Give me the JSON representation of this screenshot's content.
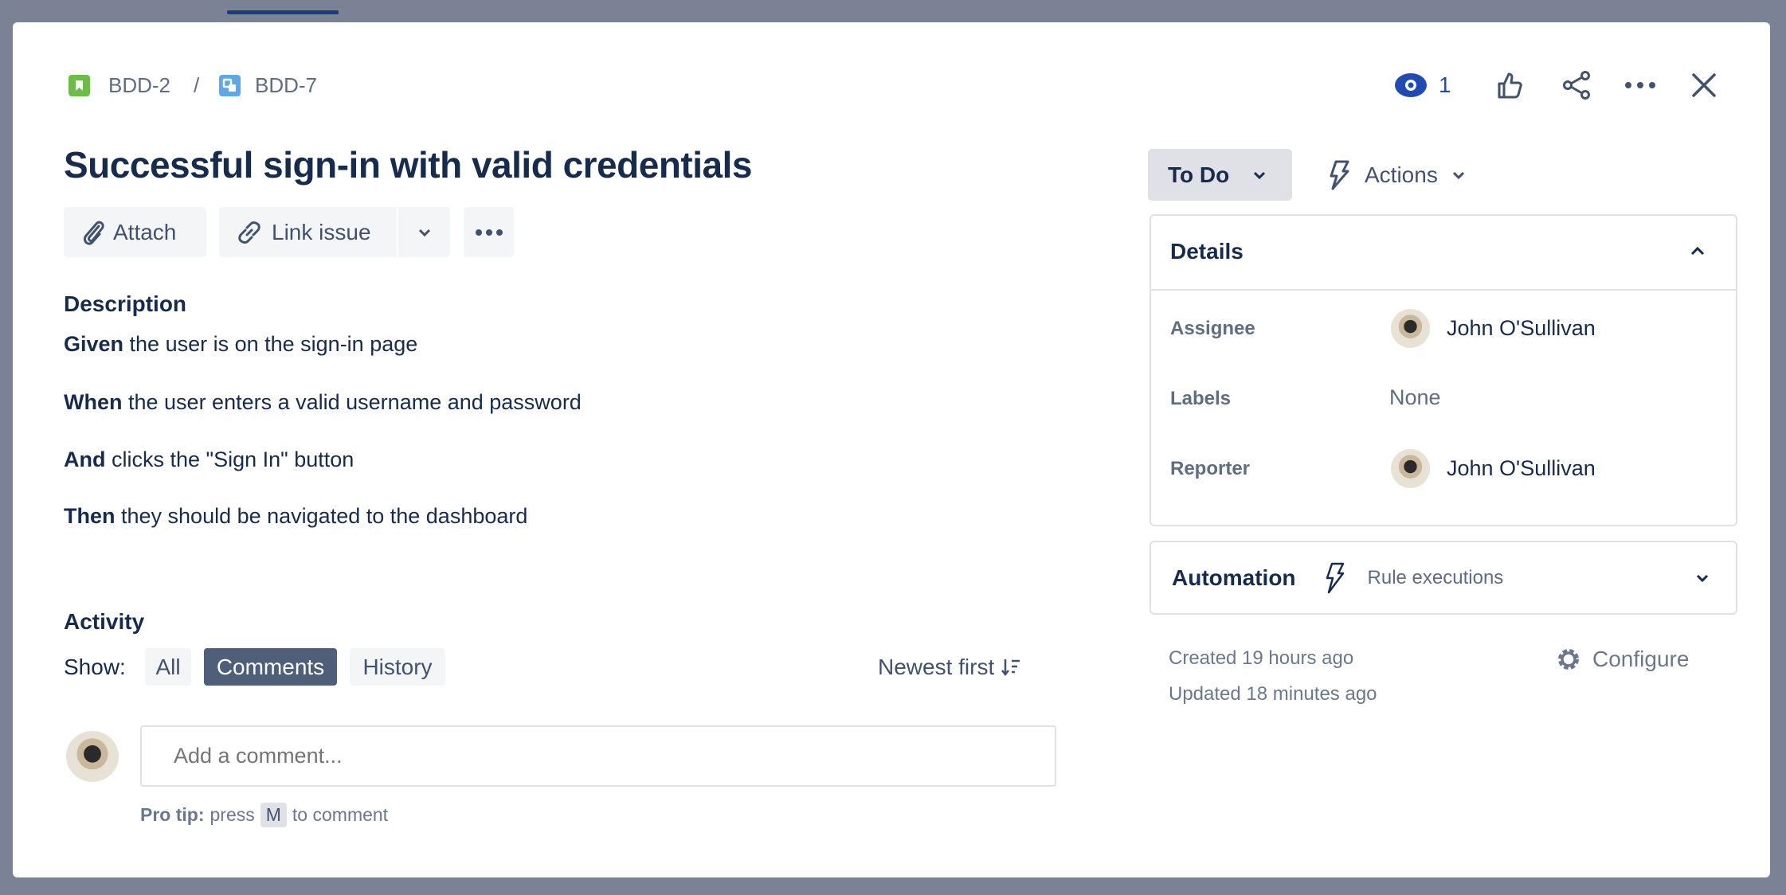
{
  "breadcrumb": {
    "parent": "BDD-2",
    "separator": "/",
    "current": "BDD-7"
  },
  "header": {
    "watch_count": "1"
  },
  "issue": {
    "title": "Successful sign-in with valid credentials"
  },
  "toolbar": {
    "attach": "Attach",
    "link_issue": "Link issue"
  },
  "description": {
    "label": "Description",
    "lines": [
      {
        "keyword": "Given",
        "text": " the user is on the sign-in page"
      },
      {
        "keyword": "When",
        "text": " the user enters a valid username and password"
      },
      {
        "keyword": "And",
        "text": " clicks the \"Sign In\" button"
      },
      {
        "keyword": "Then",
        "text": " they should be navigated to the dashboard"
      }
    ]
  },
  "activity": {
    "label": "Activity",
    "show": "Show:",
    "filters": [
      "All",
      "Comments",
      "History"
    ],
    "active_filter": "Comments",
    "sort": "Newest first",
    "comment_placeholder": "Add a comment...",
    "pro_tip_bold": "Pro tip:",
    "pro_tip_pre": "press",
    "pro_tip_key": "M",
    "pro_tip_post": "to comment"
  },
  "status": {
    "value": "To Do",
    "actions": "Actions"
  },
  "details": {
    "title": "Details",
    "assignee_label": "Assignee",
    "assignee": "John O'Sullivan",
    "labels_label": "Labels",
    "labels": "None",
    "reporter_label": "Reporter",
    "reporter": "John O'Sullivan"
  },
  "automation": {
    "title": "Automation",
    "rule": "Rule executions"
  },
  "meta": {
    "created": "Created 19 hours ago",
    "updated": "Updated 18 minutes ago",
    "configure": "Configure"
  },
  "colors": {
    "story": "#6cbb4b",
    "subtask": "#5ea8e8",
    "watch": "#1f4bb3",
    "active_filter": "#505f79"
  }
}
